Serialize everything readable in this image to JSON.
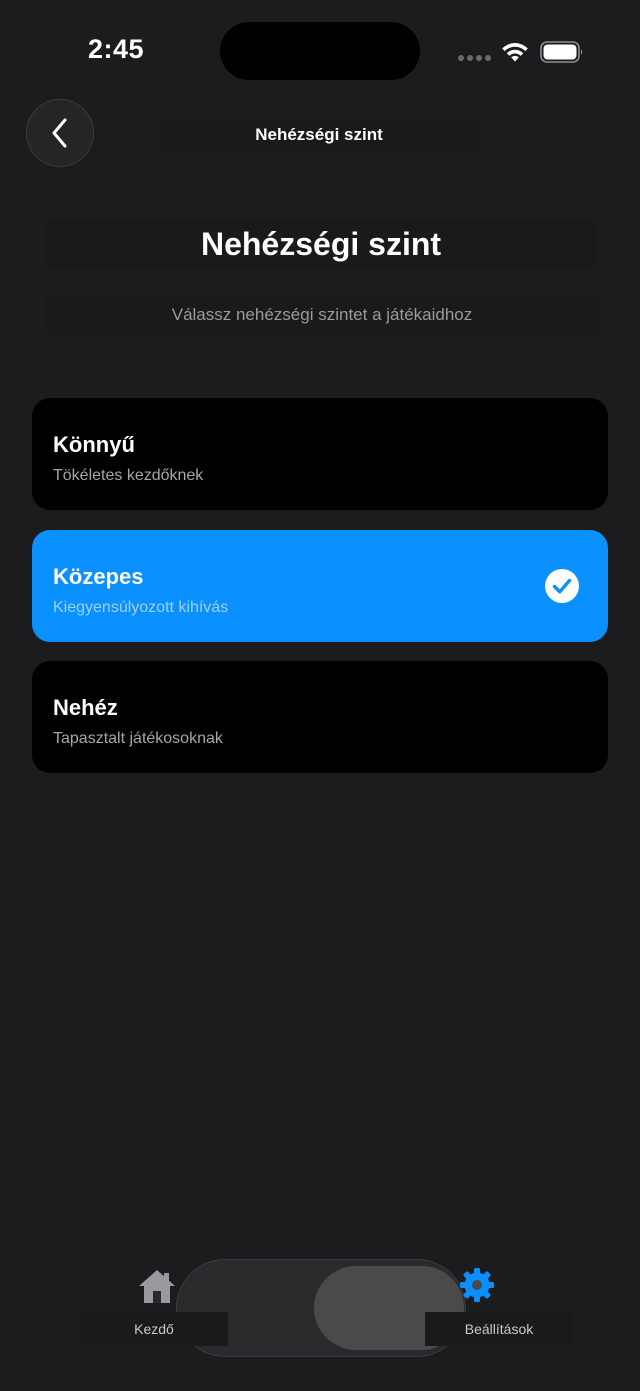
{
  "status_bar": {
    "time": "2:45"
  },
  "nav": {
    "back_icon": "chevron-left-icon",
    "title": "Nehézségi szint"
  },
  "header": {
    "title": "Nehézségi szint",
    "subtitle": "Válassz nehézségi szintet a játékaidhoz"
  },
  "options": [
    {
      "label": "Könnyű",
      "description": "Tökéletes kezdőknek",
      "selected": false
    },
    {
      "label": "Közepes",
      "description": "Kiegyensúlyozott kihívás",
      "selected": true
    },
    {
      "label": "Nehéz",
      "description": "Tapasztalt játékosoknak",
      "selected": false
    }
  ],
  "tab_bar": {
    "items": [
      {
        "label": "Kezdő",
        "icon": "home-icon",
        "active": false
      },
      {
        "label": "Beállítások",
        "icon": "gear-icon",
        "active": true
      }
    ]
  },
  "colors": {
    "background": "#1c1c1e",
    "accent": "#0a91ff",
    "card": "#000000"
  }
}
